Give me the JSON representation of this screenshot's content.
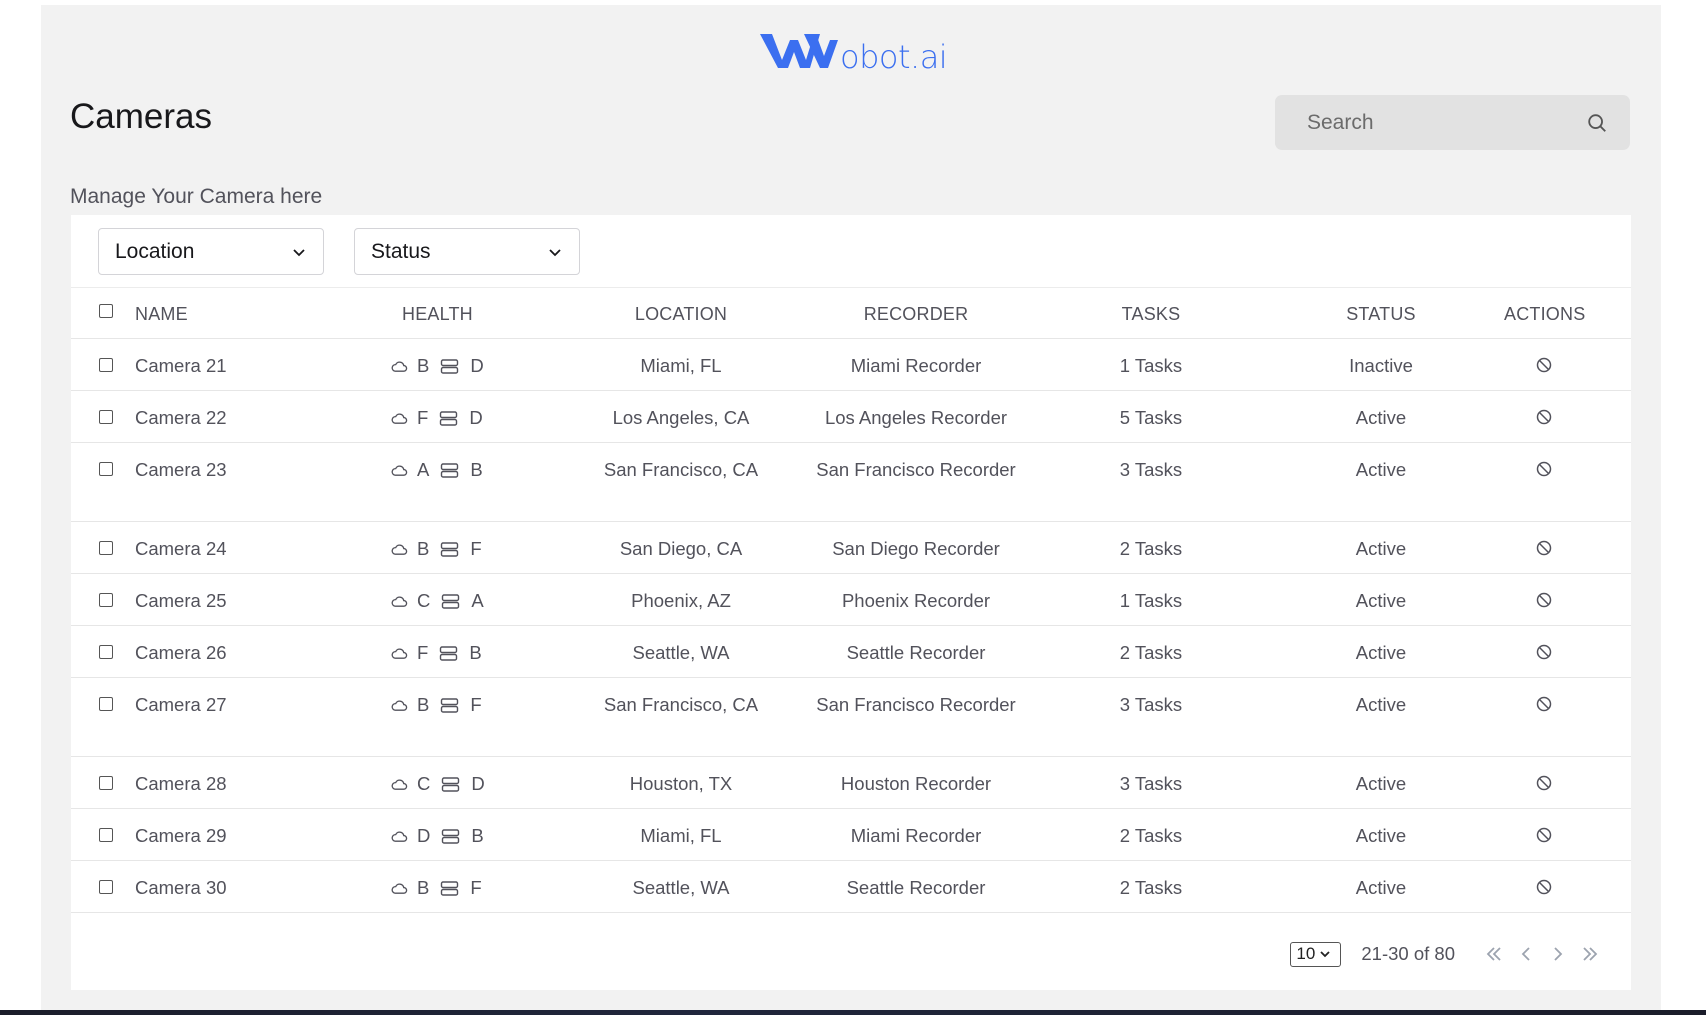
{
  "brand": {
    "logo_text": "obot.ai",
    "color": "#3b6ff0"
  },
  "header": {
    "title": "Cameras",
    "subtitle": "Manage Your Camera here"
  },
  "search": {
    "placeholder": "Search",
    "icon": "search-icon"
  },
  "filters": {
    "location_label": "Location",
    "status_label": "Status"
  },
  "table": {
    "columns": {
      "name": "NAME",
      "health": "HEALTH",
      "location": "LOCATION",
      "recorder": "RECORDER",
      "tasks": "TASKS",
      "status": "STATUS",
      "actions": "ACTIONS"
    },
    "rows": [
      {
        "name": "Camera 21",
        "health_cloud": "B",
        "health_storage": "D",
        "location": "Miami, FL",
        "recorder": "Miami Recorder",
        "tasks": "1 Tasks",
        "status": "Inactive",
        "action_icon": "ban-icon"
      },
      {
        "name": "Camera 22",
        "health_cloud": "F",
        "health_storage": "D",
        "location": "Los Angeles, CA",
        "recorder": "Los Angeles Recorder",
        "tasks": "5 Tasks",
        "status": "Active",
        "action_icon": "ban-icon"
      },
      {
        "name": "Camera 23",
        "health_cloud": "A",
        "health_storage": "B",
        "location": "San Francisco, CA",
        "recorder": "San Francisco Recorder",
        "tasks": "3 Tasks",
        "status": "Active",
        "action_icon": "ban-icon"
      },
      {
        "name": "Camera 24",
        "health_cloud": "B",
        "health_storage": "F",
        "location": "San Diego, CA",
        "recorder": "San Diego Recorder",
        "tasks": "2 Tasks",
        "status": "Active",
        "action_icon": "ban-icon"
      },
      {
        "name": "Camera 25",
        "health_cloud": "C",
        "health_storage": "A",
        "location": "Phoenix, AZ",
        "recorder": "Phoenix Recorder",
        "tasks": "1 Tasks",
        "status": "Active",
        "action_icon": "ban-icon"
      },
      {
        "name": "Camera 26",
        "health_cloud": "F",
        "health_storage": "B",
        "location": "Seattle, WA",
        "recorder": "Seattle Recorder",
        "tasks": "2 Tasks",
        "status": "Active",
        "action_icon": "ban-icon"
      },
      {
        "name": "Camera 27",
        "health_cloud": "B",
        "health_storage": "F",
        "location": "San Francisco, CA",
        "recorder": "San Francisco Recorder",
        "tasks": "3 Tasks",
        "status": "Active",
        "action_icon": "ban-icon"
      },
      {
        "name": "Camera 28",
        "health_cloud": "C",
        "health_storage": "D",
        "location": "Houston, TX",
        "recorder": "Houston Recorder",
        "tasks": "3 Tasks",
        "status": "Active",
        "action_icon": "ban-icon"
      },
      {
        "name": "Camera 29",
        "health_cloud": "D",
        "health_storage": "B",
        "location": "Miami, FL",
        "recorder": "Miami Recorder",
        "tasks": "2 Tasks",
        "status": "Active",
        "action_icon": "ban-icon"
      },
      {
        "name": "Camera 30",
        "health_cloud": "B",
        "health_storage": "F",
        "location": "Seattle, WA",
        "recorder": "Seattle Recorder",
        "tasks": "2 Tasks",
        "status": "Active",
        "action_icon": "ban-icon"
      }
    ]
  },
  "pagination": {
    "page_size": "10",
    "range": "21-30 of 80"
  }
}
